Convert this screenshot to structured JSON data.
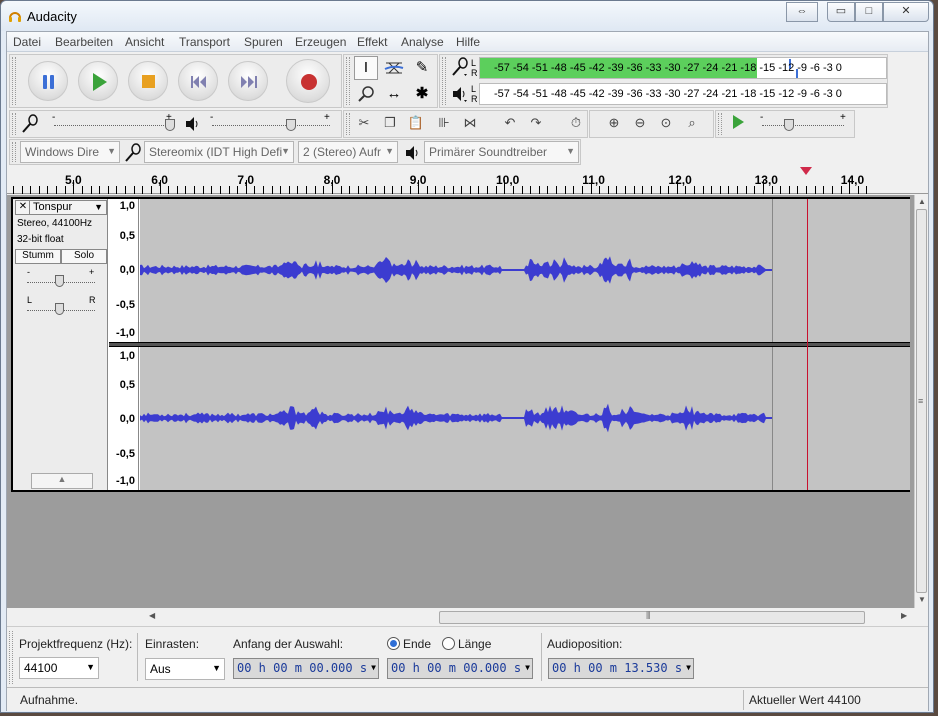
{
  "window": {
    "title": "Audacity",
    "btn_restore": "⇔",
    "btn_min": "▭",
    "btn_max": "□",
    "btn_close": "✕"
  },
  "menu": [
    "Datei",
    "Bearbeiten",
    "Ansicht",
    "Transport",
    "Spuren",
    "Erzeugen",
    "Effekt",
    "Analyse",
    "Hilfe"
  ],
  "meters": {
    "rec_l": "L",
    "rec_r": "R",
    "play_l": "L",
    "play_r": "R",
    "scale": "-57 -54 -51 -48 -45 -42 -39 -36 -33 -30 -27 -24 -21 -18 -15 -12  -9  -6  -3  0",
    "rec_level": 0.68
  },
  "devices": {
    "host": "Windows Dire",
    "input": "Stereomix (IDT High Defi",
    "channels": "2 (Stereo) Aufr",
    "output": "Primärer Soundtreiber"
  },
  "ruler": [
    "5,0",
    "6,0",
    "7,0",
    "8,0",
    "9,0",
    "10,0",
    "11,0",
    "12,0",
    "13,0",
    "14,0"
  ],
  "track": {
    "close": "✕",
    "name": "Tonspur",
    "info1": "Stereo, 44100Hz",
    "info2": "32-bit float",
    "mute": "Stumm",
    "solo": "Solo",
    "gain_minus": "-",
    "gain_plus": "+",
    "pan_l": "L",
    "pan_r": "R",
    "vlabels": [
      "1,0",
      "0,5",
      "0,0",
      "-0,5",
      "-1,0"
    ]
  },
  "bottom": {
    "rate_label": "Projektfrequenz (Hz):",
    "rate_value": "44100",
    "snap_label": "Einrasten:",
    "snap_value": "Aus",
    "sel_start_label": "Anfang der Auswahl:",
    "end_label": "Ende",
    "length_label": "Länge",
    "sel_start": "00 h 00 m 00.000 s",
    "sel_end": "00 h 00 m 00.000 s",
    "audiopos_label": "Audioposition:",
    "audiopos": "00 h 00 m 13.530 s"
  },
  "status": {
    "left": "Aufnahme.",
    "right": "Aktueller Wert 44100"
  },
  "colors": {
    "wave": "#3c3cd0",
    "cursor": "#c8102e",
    "meter": "#5ccf5c"
  }
}
